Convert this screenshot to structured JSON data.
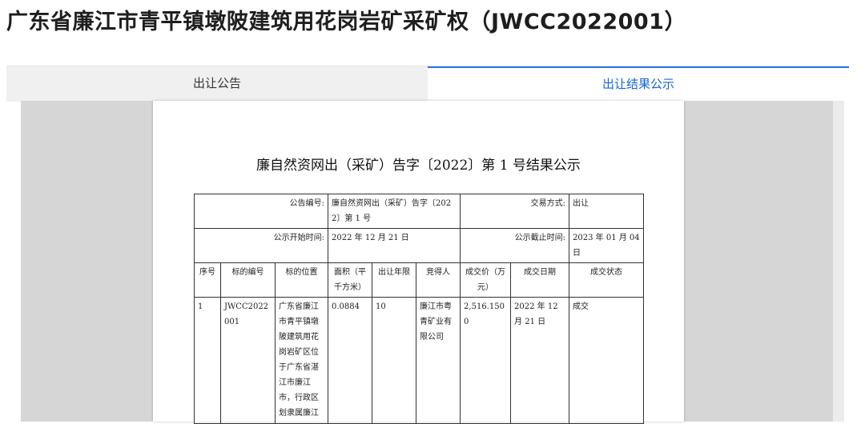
{
  "page": {
    "title": "广东省廉江市青平镇墩陂建筑用花岗岩矿采矿权（JWCC2022001）"
  },
  "tabs": [
    {
      "label": "出让公告",
      "active": false
    },
    {
      "label": "出让结果公示",
      "active": true
    }
  ],
  "colors": {
    "accent": "#2a73e0",
    "active_tab_text": "#1565d8",
    "viewer_bg": "#d6d6d6"
  },
  "document": {
    "title": "廉自然资网出（采矿）告字〔2022〕第 1 号结果公示",
    "info": {
      "notice_no_label": "公告编号:",
      "notice_no": "廉自然资网出（采矿）告字〔2022〕第 1 号",
      "trade_method_label": "交易方式:",
      "trade_method": "出让",
      "start_label": "公示开始时间:",
      "start": "2022 年 12 月 21 日",
      "end_label": "公示截止时间:",
      "end": "2023 年 01 月 04 日"
    },
    "headers": [
      "序号",
      "标的编号",
      "标的位置",
      "面积（平千方米）",
      "出让年限",
      "竞得人",
      "成交价（万元）",
      "成交日期",
      "成交状态"
    ],
    "rows": [
      {
        "no": "1",
        "code": "JWCC2022001",
        "location": "广东省廉江市青平镇墩陂建筑用花岗岩矿区位于广东省湛江市廉江市，行政区划隶属廉江",
        "area": "0.0884",
        "years": "10",
        "winner": "廉江市粤青矿业有限公司",
        "price": "2,516.1500",
        "date": "2022 年 12 月 21 日",
        "status": "成交"
      }
    ]
  }
}
